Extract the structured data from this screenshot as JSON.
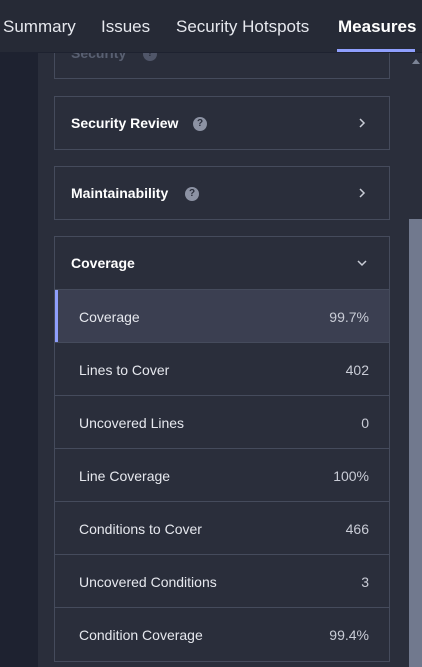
{
  "tabs": [
    {
      "label": "Summary"
    },
    {
      "label": "Issues"
    },
    {
      "label": "Security Hotspots"
    },
    {
      "label": "Measures",
      "active": true
    }
  ],
  "cards": {
    "security": {
      "title": "Security"
    },
    "security_review": {
      "title": "Security Review"
    },
    "maintainability": {
      "title": "Maintainability"
    },
    "coverage": {
      "title": "Coverage"
    }
  },
  "help_glyph": "?",
  "coverage_rows": [
    {
      "label": "Coverage",
      "value": "99.7%",
      "selected": true
    },
    {
      "label": "Lines to Cover",
      "value": "402"
    },
    {
      "label": "Uncovered Lines",
      "value": "0"
    },
    {
      "label": "Line Coverage",
      "value": "100%"
    },
    {
      "label": "Conditions to Cover",
      "value": "466"
    },
    {
      "label": "Uncovered Conditions",
      "value": "3"
    },
    {
      "label": "Condition Coverage",
      "value": "99.4%"
    }
  ],
  "colors": {
    "accent": "#8f9ffd",
    "background": "#2a2e3b",
    "selected_row": "#3b3f51"
  }
}
